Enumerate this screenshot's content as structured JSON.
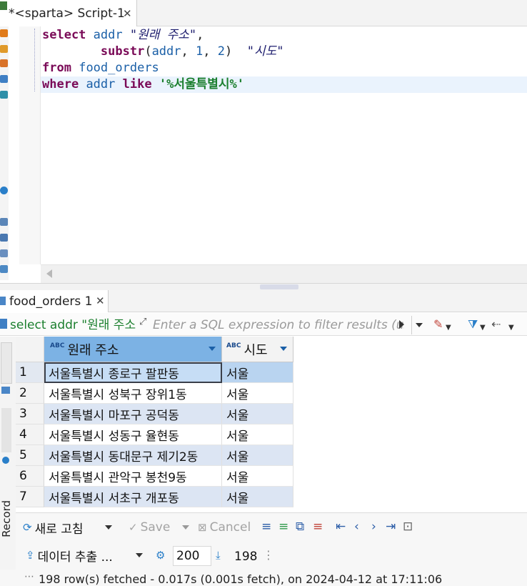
{
  "editor_tab": {
    "title": "*<sparta> Script-1",
    "close_glyph": "✕"
  },
  "sql": {
    "line1_kw": "select",
    "line1_col": "addr",
    "line1_alias": "\"원래 주소\"",
    "line1_comma": ",",
    "line2_fn": "substr",
    "line2_arg_col": "addr",
    "line2_arg_start": "1",
    "line2_arg_len": "2",
    "line2_alias": "\"시도\"",
    "line3_kw": "from",
    "line3_table": "food_orders",
    "line4_kw": "where",
    "line4_col": "addr",
    "line4_op": "like",
    "line4_pattern": "'%서울특별시%'"
  },
  "results_tab": {
    "title": "food_orders 1",
    "close_glyph": "✕"
  },
  "filter_bar": {
    "query_preview": "select addr \"원래 주소",
    "placeholder": "Enter a SQL expression to filter results (use Ctrl+Space)"
  },
  "grid": {
    "columns": [
      "원래 주소",
      "시도"
    ],
    "column_type_badge": "ABC",
    "rows": [
      {
        "n": "1",
        "addr": "서울특별시 종로구 팔판동",
        "sido": "서울"
      },
      {
        "n": "2",
        "addr": "서울특별시 성북구 장위1동",
        "sido": "서울"
      },
      {
        "n": "3",
        "addr": "서울특별시 마포구 공덕동",
        "sido": "서울"
      },
      {
        "n": "4",
        "addr": "서울특별시 성동구 율현동",
        "sido": "서울"
      },
      {
        "n": "5",
        "addr": "서울특별시 동대문구 제기2동",
        "sido": "서울"
      },
      {
        "n": "6",
        "addr": "서울특별시 관악구 봉천9동",
        "sido": "서울"
      },
      {
        "n": "7",
        "addr": "서울특별시 서초구 개포동",
        "sido": "서울"
      }
    ]
  },
  "toolbar": {
    "refresh_label": "새로 고침",
    "save_label": "Save",
    "cancel_label": "Cancel"
  },
  "export_bar": {
    "export_label": "데이터 추출 ...",
    "fetch_size": "200",
    "row_count": "198"
  },
  "side_panel": {
    "record_label": "Record"
  },
  "status": {
    "text": "198 row(s) fetched - 0.017s (0.001s fetch), on 2024-04-12 at 17:11:06"
  },
  "colors": {
    "keyword": "#7a0a57",
    "identifier": "#1a5fa7",
    "string": "#1b7f2e",
    "header_selected": "#7cb2e4",
    "row_alt": "#dce5f3"
  }
}
